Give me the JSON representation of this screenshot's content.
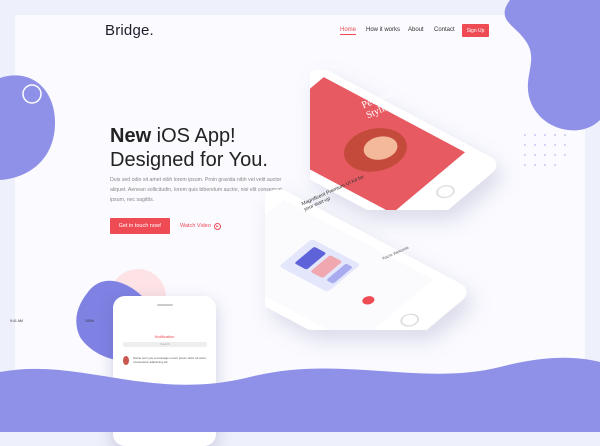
{
  "brand": {
    "logo": "Bridge."
  },
  "nav": {
    "items": [
      {
        "label": "Home",
        "active": true
      },
      {
        "label": "How it works",
        "active": false
      },
      {
        "label": "About",
        "active": false
      },
      {
        "label": "Contact",
        "active": false
      }
    ],
    "signup_label": "Sign Up"
  },
  "hero": {
    "title_bold": "New",
    "title_rest": " iOS App!",
    "title_line2": "Designed for You.",
    "description": "Duis sed odio sit amet nibh lorem ipsum. Proin gravida nibh vel velit auctor aliquet. Aenean sollicitudin, lorem quis bibendum auctor, nisi elit consequat ipsum, nec sagittis.",
    "cta_label": "Get in touch now!",
    "watch_label": "Watch Video"
  },
  "phone_top": {
    "headline": "Personal Stylist"
  },
  "phone_middle": {
    "headline": "Magnificent Premium UI Kit for your start-up",
    "welcome": "You're Welcome"
  },
  "phone_bottom": {
    "time": "9:41 AM",
    "battery": "100%",
    "title": "Notification",
    "search_placeholder": "Search",
    "item_text": "Name sent you a message Lorem ipsum dolor sit amet, consectetur adipiscing elit"
  },
  "colors": {
    "accent": "#ef4b55",
    "blob": "#8b8de6",
    "background": "#fafaff"
  },
  "icons": [
    "play-icon",
    "search-icon"
  ]
}
